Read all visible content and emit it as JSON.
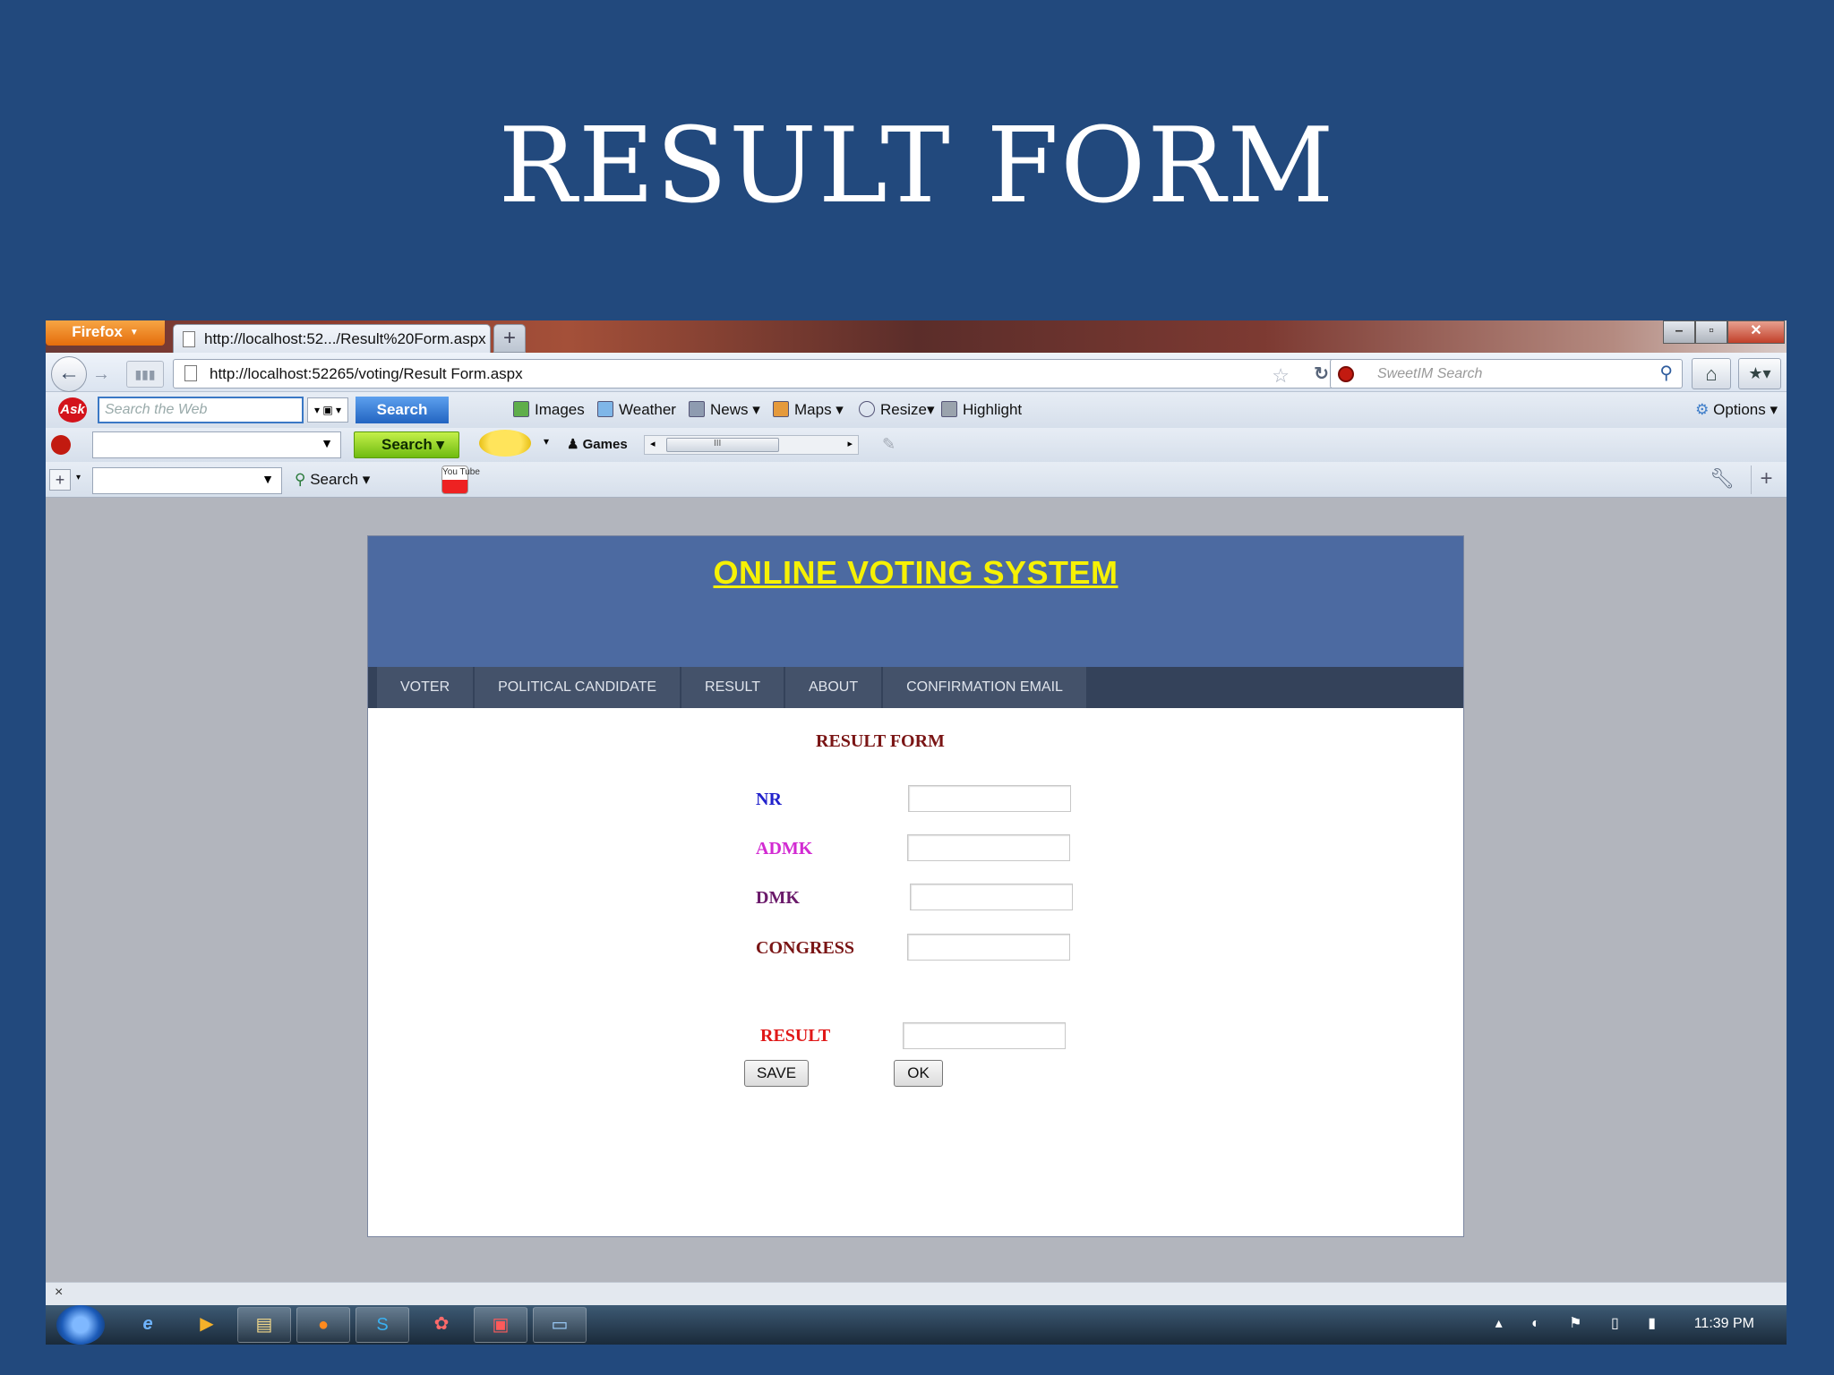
{
  "slide": {
    "title": "RESULT FORM"
  },
  "browser": {
    "app_menu": "Firefox",
    "tab_title": "http://localhost:52.../Result%20Form.aspx",
    "new_tab": "+",
    "url": "http://localhost:52265/voting/Result Form.aspx",
    "search_placeholder": "SweetIM Search",
    "window_buttons": {
      "minimize": "–",
      "maximize": "▫",
      "close": "✕"
    }
  },
  "toolbar1": {
    "ask_logo": "Ask",
    "search_placeholder": "Search the Web",
    "search_button": "Search",
    "items": [
      "Images",
      "Weather",
      "News",
      "Maps",
      "Resize",
      "Highlight"
    ],
    "options": "Options"
  },
  "toolbar2": {
    "search_button": "Search",
    "games": "Games",
    "scroll_label": "III"
  },
  "toolbar3": {
    "search": "Search",
    "youtube": "You Tube"
  },
  "page": {
    "site_title": "ONLINE VOTING SYSTEM",
    "menu": [
      "VOTER",
      "POLITICAL CANDIDATE",
      "RESULT",
      "ABOUT",
      "CONFIRMATION EMAIL"
    ],
    "form_title": "RESULT FORM",
    "fields": [
      {
        "label": "NR",
        "value": "",
        "color": "#2222cc"
      },
      {
        "label": "ADMK",
        "value": "",
        "color": "#d22ad2"
      },
      {
        "label": "DMK",
        "value": "",
        "color": "#6a1a6a"
      },
      {
        "label": "CONGRESS",
        "value": "",
        "color": "#7a1515"
      },
      {
        "label": "RESULT",
        "value": "",
        "color": "#e01818"
      }
    ],
    "buttons": {
      "save": "SAVE",
      "ok": "OK"
    }
  },
  "statusbar": {
    "close": "×"
  },
  "taskbar": {
    "clock": "11:39 PM"
  },
  "colors": {
    "background": "#22497d",
    "header": "#4c6aa1",
    "site_title": "#f6f104",
    "menu_bar": "#34425a"
  }
}
